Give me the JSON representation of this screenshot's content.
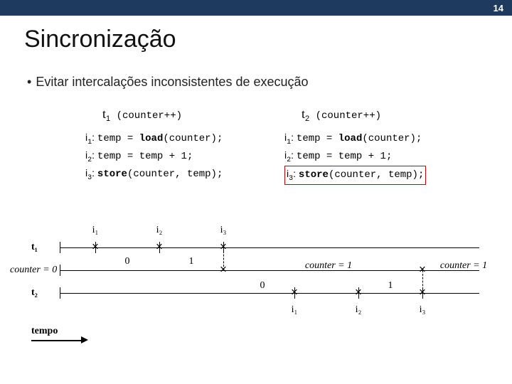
{
  "slide_number": "14",
  "title": "Sincronização",
  "bullet": "Evitar intercalações inconsistentes de execução",
  "columns": {
    "left": {
      "header_var": "t",
      "header_sub": "1",
      "header_incr": "(counter++)",
      "lines": [
        {
          "ilabel": "i",
          "isub": "1",
          "pre": "temp = ",
          "kw": "load",
          "post": "(counter);",
          "boxed": false
        },
        {
          "ilabel": "i",
          "isub": "2",
          "pre": "temp = temp + 1;",
          "kw": "",
          "post": "",
          "boxed": false
        },
        {
          "ilabel": "i",
          "isub": "3",
          "pre": "",
          "kw": "store",
          "post": "(counter, temp);",
          "boxed": false
        }
      ]
    },
    "right": {
      "header_var": "t",
      "header_sub": "2",
      "header_incr": "(counter++)",
      "lines": [
        {
          "ilabel": "i",
          "isub": "1",
          "pre": "temp = ",
          "kw": "load",
          "post": "(counter);",
          "boxed": false
        },
        {
          "ilabel": "i",
          "isub": "2",
          "pre": "temp = temp + 1;",
          "kw": "",
          "post": "",
          "boxed": false
        },
        {
          "ilabel": "i",
          "isub": "3",
          "pre": "",
          "kw": "store",
          "post": "(counter, temp);",
          "boxed": true
        }
      ]
    }
  },
  "diagram": {
    "row_t1_label": "t₁",
    "row_t2_label": "t₂",
    "counter0": "counter = 0",
    "counter1a": "counter = 1",
    "counter1b": "counter = 1",
    "top_ticks": [
      "i₁",
      "i₂",
      "i₃"
    ],
    "bot_ticks": [
      "i₁",
      "i₂",
      "i₃"
    ],
    "top_vals": [
      "0",
      "1"
    ],
    "bot_vals": [
      "0",
      "1"
    ],
    "time_label": "tempo"
  }
}
